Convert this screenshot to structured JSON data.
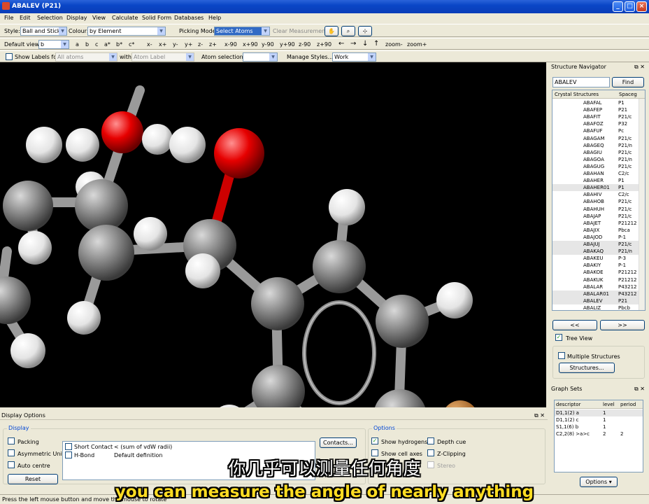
{
  "window": {
    "title": "ABALEV (P21)"
  },
  "menu": [
    "File",
    "Edit",
    "Selection",
    "Display",
    "View",
    "Calculate",
    "Solid Form",
    "Databases",
    "Help"
  ],
  "toolbar1": {
    "style_label": "Style:",
    "style_value": "Ball and Stick",
    "colour_label": "Colour:",
    "colour_value": "by Element",
    "picking_label": "Picking Mode:",
    "picking_value": "Select Atoms",
    "clear_label": "Clear Measurements"
  },
  "toolbar2": {
    "default_view_label": "Default view:",
    "default_view_value": "b",
    "axes": [
      "a",
      "b",
      "c",
      "a*",
      "b*",
      "c*"
    ],
    "rotations": [
      "x-",
      "x+",
      "y-",
      "y+",
      "z-",
      "z+",
      "x-90",
      "x+90",
      "y-90",
      "y+90",
      "z-90",
      "z+90"
    ],
    "arrows": [
      "←",
      "→",
      "↓",
      "↑"
    ],
    "zoom": [
      "zoom-",
      "zoom+"
    ]
  },
  "toolbar3": {
    "show_labels": "Show Labels for",
    "labels_for_value": "All atoms",
    "with_label": "with",
    "with_value": "Atom Label",
    "atom_selections": "Atom selections:",
    "atom_sel_value": "",
    "manage_styles": "Manage Styles...",
    "style_set": "Work"
  },
  "navigator": {
    "title": "Structure Navigator",
    "search_value": "ABALEV",
    "find_label": "Find",
    "col1": "Crystal Structures",
    "col2": "Spaceg",
    "rows": [
      [
        "ABAFAL",
        "P1"
      ],
      [
        "ABAFEP",
        "P21"
      ],
      [
        "ABAFIT",
        "P21/c"
      ],
      [
        "ABAFOZ",
        "P32"
      ],
      [
        "ABAFUF",
        "Pc"
      ],
      [
        "ABAGAM",
        "P21/c"
      ],
      [
        "ABAGEQ",
        "P21/n"
      ],
      [
        "ABAGIU",
        "P21/c"
      ],
      [
        "ABAGOA",
        "P21/n"
      ],
      [
        "ABAGUG",
        "P21/c"
      ],
      [
        "ABAHAN",
        "C2/c"
      ],
      [
        "ABAHER",
        "P1"
      ],
      [
        "ABAHER01",
        "P1"
      ],
      [
        "ABAHIV",
        "C2/c"
      ],
      [
        "ABAHOB",
        "P21/c"
      ],
      [
        "ABAHUH",
        "P21/c"
      ],
      [
        "ABAJAP",
        "P21/c"
      ],
      [
        "ABAJET",
        "P21212"
      ],
      [
        "ABAJIX",
        "Pbca"
      ],
      [
        "ABAJOD",
        "P-1"
      ],
      [
        "ABAJUJ",
        "P21/c"
      ],
      [
        "ABAKAQ",
        "P21/n"
      ],
      [
        "ABAKEU",
        "P-3"
      ],
      [
        "ABAKIY",
        "P-1"
      ],
      [
        "ABAKOE",
        "P21212"
      ],
      [
        "ABAKUK",
        "P21212"
      ],
      [
        "ABALAR",
        "P43212"
      ],
      [
        "ABALAR01",
        "P43212"
      ],
      [
        "ABALEV",
        "P21"
      ],
      [
        "ABALIZ",
        "Pbcb"
      ]
    ],
    "prev": "<<",
    "next": ">>",
    "tree_view": "Tree View",
    "multiple": "Multiple Structures",
    "structures_btn": "Structures..."
  },
  "graphsets": {
    "title": "Graph Sets",
    "headers": [
      "descriptor",
      "level",
      "period"
    ],
    "rows": [
      [
        "D1,1(2) a",
        "1",
        ""
      ],
      [
        "D1,1(2) c",
        "1",
        ""
      ],
      [
        "S1,1(6) b",
        "1",
        ""
      ],
      [
        "C2,2(8) >a>c",
        "2",
        "2"
      ]
    ],
    "options_btn": "Options"
  },
  "display_options": {
    "title": "Display Options",
    "display_group": "Display",
    "checks": [
      "Packing",
      "Asymmetric Unit",
      "Auto centre"
    ],
    "reset": "Reset",
    "contacts": [
      [
        "Short Contact",
        "< (sum of vdW radii)"
      ],
      [
        "H-Bond",
        "Default definition"
      ]
    ],
    "contacts_btn": "Contacts...",
    "options_group": "Options",
    "opt_checks": [
      "Show hydrogens",
      "Show cell axes",
      "Depth cue",
      "Z-Clipping",
      "Stereo"
    ]
  },
  "status": "Press the left mouse button and move the mouse to rotate",
  "subtitles": {
    "zh": "你几乎可以测量任何角度",
    "en": "you can measure the angle of nearly anything"
  }
}
